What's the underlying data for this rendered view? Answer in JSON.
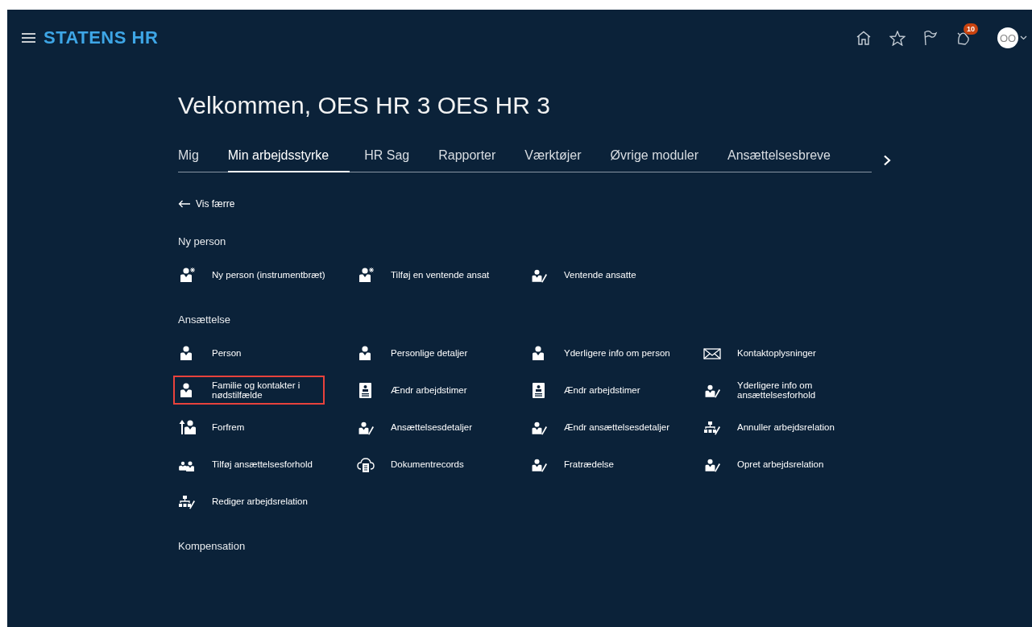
{
  "header": {
    "brand": "STATENS HR",
    "notification_count": "10",
    "avatar_initials": "OO"
  },
  "greeting": "Velkommen, OES HR 3 OES HR 3",
  "tabs": [
    {
      "label": "Mig",
      "selected": false
    },
    {
      "label": "Min arbejdsstyrke",
      "selected": true
    },
    {
      "label": "HR Sag",
      "selected": false
    },
    {
      "label": "Rapporter",
      "selected": false
    },
    {
      "label": "Værktøjer",
      "selected": false
    },
    {
      "label": "Øvrige moduler",
      "selected": false
    },
    {
      "label": "Ansættelsesbreve",
      "selected": false
    }
  ],
  "back_link": "Vis færre",
  "sections": [
    {
      "title": "Ny person",
      "items": [
        {
          "label": "Ny person (instrumentbræt)",
          "kind": "person-new",
          "highlighted": false
        },
        {
          "label": "Tilføj en ventende ansat",
          "kind": "person-new",
          "highlighted": false
        },
        {
          "label": "Ventende ansatte",
          "kind": "person-edit",
          "highlighted": false
        }
      ]
    },
    {
      "title": "Ansættelse",
      "items": [
        {
          "label": "Person",
          "kind": "person",
          "highlighted": false
        },
        {
          "label": "Personlige detaljer",
          "kind": "person",
          "highlighted": false
        },
        {
          "label": "Yderligere info om person",
          "kind": "person",
          "highlighted": false
        },
        {
          "label": "Kontaktoplysninger",
          "kind": "envelope",
          "highlighted": false
        },
        {
          "label": "Familie og kontakter i nødstilfælde",
          "kind": "person",
          "highlighted": true
        },
        {
          "label": "Ændr arbejdstimer",
          "kind": "badge",
          "highlighted": false
        },
        {
          "label": "Ændr arbejdstimer",
          "kind": "badge",
          "highlighted": false
        },
        {
          "label": "Yderligere info om ansættelsesforhold",
          "kind": "person-edit",
          "highlighted": false
        },
        {
          "label": "Forfrem",
          "kind": "promote",
          "highlighted": false
        },
        {
          "label": "Ansættelsesdetaljer",
          "kind": "person-edit",
          "highlighted": false
        },
        {
          "label": "Ændr ansættelsesdetaljer",
          "kind": "person-edit",
          "highlighted": false
        },
        {
          "label": "Annuller arbejdsrelation",
          "kind": "org-edit",
          "highlighted": false
        },
        {
          "label": "Tilføj ansættelsesforhold",
          "kind": "people",
          "highlighted": false
        },
        {
          "label": "Dokumentrecords",
          "kind": "cloud",
          "highlighted": false
        },
        {
          "label": "Fratrædelse",
          "kind": "person-edit",
          "highlighted": false
        },
        {
          "label": "Opret arbejdsrelation",
          "kind": "person-edit",
          "highlighted": false
        },
        {
          "label": "Rediger arbejdsrelation",
          "kind": "org-edit",
          "highlighted": false
        }
      ]
    },
    {
      "title": "Kompensation"
    }
  ]
}
